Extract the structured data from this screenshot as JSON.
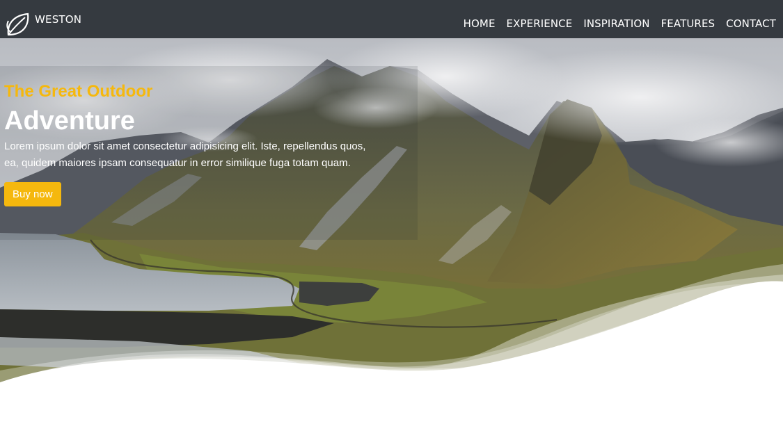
{
  "brand": {
    "name": "WESTON",
    "logo_icon": "leaf-icon"
  },
  "nav": {
    "items": [
      {
        "label": "HOME"
      },
      {
        "label": "EXPERIENCE"
      },
      {
        "label": "INSPIRATION"
      },
      {
        "label": "FEATURES"
      },
      {
        "label": "CONTACT"
      }
    ]
  },
  "hero": {
    "subtitle": "The Great Outdoor",
    "title": "Adventure",
    "description": "Lorem ipsum dolor sit amet consectetur adipisicing elit. Iste, repellendus quos, ea, quidem maiores ipsam consequatur in error similique fuga totam quam.",
    "button_label": "Buy now"
  },
  "colors": {
    "navbar": "#353a40",
    "accent": "#f5b80e",
    "text_light": "#ffffff"
  }
}
